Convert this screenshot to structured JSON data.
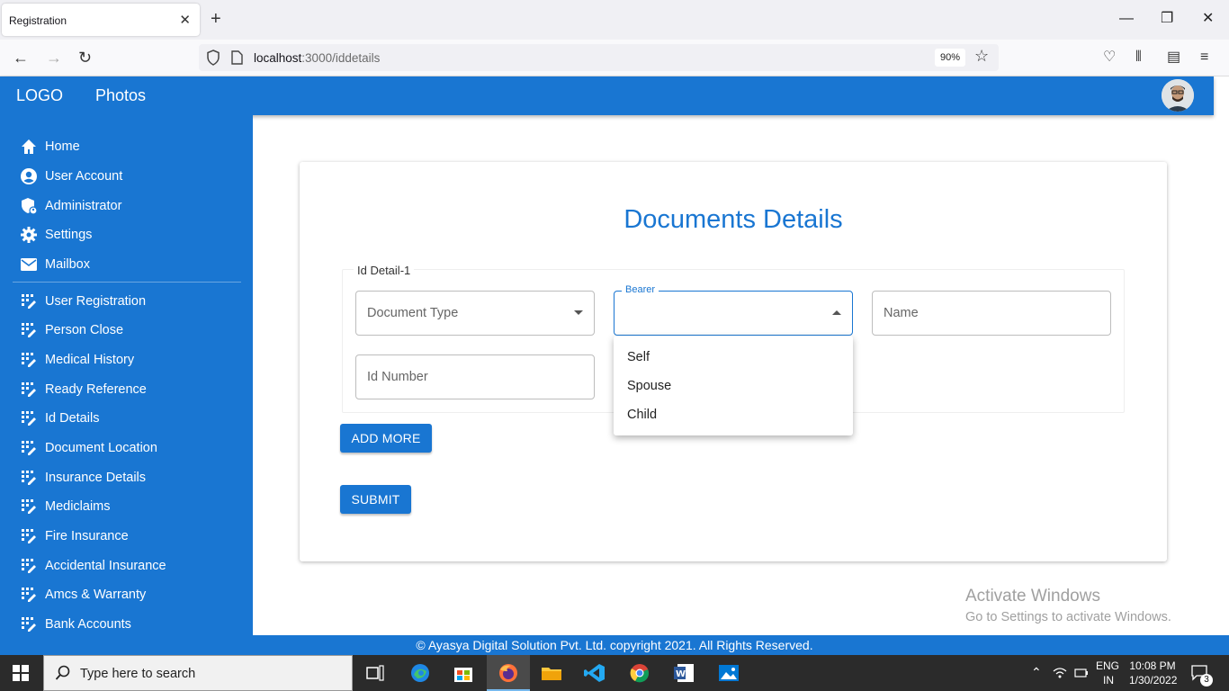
{
  "browser": {
    "tab_title": "Registration",
    "url_host": "localhost",
    "url_path": ":3000/iddetails",
    "zoom": "90%"
  },
  "header": {
    "logo": "LOGO",
    "photos": "Photos"
  },
  "sidebar": {
    "primary": [
      {
        "label": "Home",
        "icon": "home-icon"
      },
      {
        "label": "User Account",
        "icon": "account-circle-icon"
      },
      {
        "label": "Administrator",
        "icon": "admin-shield-icon"
      },
      {
        "label": "Settings",
        "icon": "gear-icon"
      },
      {
        "label": "Mailbox",
        "icon": "mail-icon"
      }
    ],
    "secondary": [
      {
        "label": "User Registration"
      },
      {
        "label": "Person Close"
      },
      {
        "label": "Medical History"
      },
      {
        "label": "Ready Reference"
      },
      {
        "label": "Id Details"
      },
      {
        "label": "Document Location"
      },
      {
        "label": "Insurance Details"
      },
      {
        "label": "Mediclaims"
      },
      {
        "label": "Fire Insurance"
      },
      {
        "label": "Accidental Insurance"
      },
      {
        "label": "Amcs & Warranty"
      },
      {
        "label": "Bank Accounts"
      }
    ]
  },
  "main": {
    "title": "Documents Details",
    "fieldset_legend": "Id Detail-1",
    "document_type_placeholder": "Document Type",
    "bearer_label": "Bearer",
    "name_placeholder": "Name",
    "id_number_placeholder": "Id Number",
    "add_more_label": "ADD MORE",
    "submit_label": "SUBMIT",
    "bearer_options": [
      "Self",
      "Spouse",
      "Child"
    ]
  },
  "watermark": {
    "line1": "Activate Windows",
    "line2": "Go to Settings to activate Windows."
  },
  "footer": {
    "text": "© Ayasya Digital Solution Pvt. Ltd. copyright 2021. All Rights Reserved."
  },
  "taskbar": {
    "search_placeholder": "Type here to search",
    "lang_line1": "ENG",
    "lang_line2": "IN",
    "time": "10:08 PM",
    "date": "1/30/2022",
    "notification_count": "3"
  },
  "colors": {
    "brand": "#1976d2",
    "text": "#222222"
  }
}
